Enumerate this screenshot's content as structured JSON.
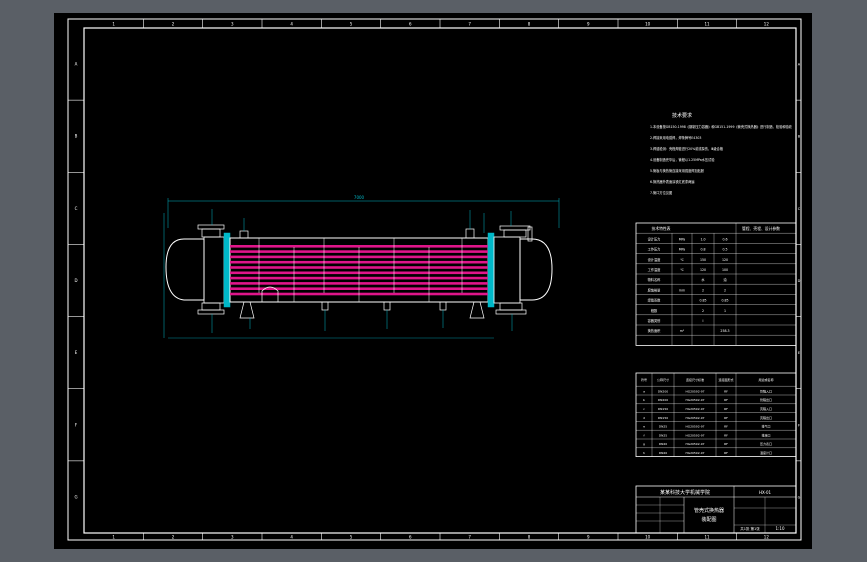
{
  "colors": {
    "background": "#000000",
    "frame": "#ffffff",
    "dimension": "#00b8c8",
    "tubes": "#e0158a",
    "shell": "#ffffff",
    "annotation": "#ffffff"
  },
  "border": {
    "top_columns": [
      "1",
      "2",
      "3",
      "4",
      "5",
      "6",
      "7",
      "8",
      "9",
      "10",
      "11",
      "12"
    ],
    "bottom_columns": [
      "1",
      "2",
      "3",
      "4",
      "5",
      "6",
      "7",
      "8",
      "9",
      "10",
      "11",
      "12"
    ],
    "left_rows": [
      "A",
      "B",
      "C",
      "D",
      "E",
      "F",
      "G"
    ],
    "right_rows": [
      "A",
      "B",
      "C",
      "D",
      "E",
      "F",
      "G"
    ]
  },
  "technical_requirements": {
    "title": "技术要求",
    "lines": [
      "1.本设备按GB150-1998《钢制压力容器》和GB151-1999《管壳式换热器》进行制造、检验和验收",
      "2.焊接采用电弧焊，焊条牌号E4303",
      "3.焊缝检测：壳程焊缝进行20%射线探伤，Ⅲ级合格",
      "4.设备制造完毕后，管程以1.25MPa水压试验",
      "5.管板与换热管连接采用强度焊加贴胀",
      "6.换热器外表面涂铁红底漆两遍",
      "7.管口方位见图"
    ]
  },
  "design_table": {
    "header": [
      "技术特性表",
      "",
      "管程、壳程、设计参数"
    ],
    "rows": [
      [
        "设计压力",
        "MPa",
        "1.0",
        "0.6"
      ],
      [
        "工作压力",
        "MPa",
        "0.8",
        "0.5"
      ],
      [
        "设计温度",
        "℃",
        "150",
        "120"
      ],
      [
        "工作温度",
        "℃",
        "120",
        "100"
      ],
      [
        "物料名称",
        "",
        "水",
        "油"
      ],
      [
        "腐蚀裕量",
        "mm",
        "2",
        "2"
      ],
      [
        "焊缝系数",
        "",
        "0.85",
        "0.85"
      ],
      [
        "程数",
        "",
        "2",
        "1"
      ],
      [
        "容器类别",
        "",
        "Ⅰ",
        ""
      ],
      [
        "换热面积",
        "m²",
        "",
        "258.3"
      ]
    ]
  },
  "nozzle_table": {
    "header": [
      "符号",
      "公称尺寸",
      "连接尺寸标准",
      "连接面形式",
      "用途或名称"
    ],
    "rows": [
      [
        "a",
        "DN200",
        "HG20592-97",
        "RF",
        "管程入口"
      ],
      [
        "b",
        "DN200",
        "HG20592-97",
        "RF",
        "管程出口"
      ],
      [
        "c",
        "DN150",
        "HG20592-97",
        "RF",
        "壳程入口"
      ],
      [
        "d",
        "DN150",
        "HG20592-97",
        "RF",
        "壳程出口"
      ],
      [
        "e",
        "DN25",
        "HG20592-97",
        "RF",
        "排气口"
      ],
      [
        "f",
        "DN25",
        "HG20592-97",
        "RF",
        "排液口"
      ],
      [
        "g",
        "DN20",
        "HG20592-97",
        "RF",
        "压力表口"
      ],
      [
        "h",
        "DN20",
        "HG20592-97",
        "RF",
        "温度计口"
      ]
    ]
  },
  "title_block": {
    "school": "某某科技大学机械学院",
    "drawing_title": "管壳式换热器",
    "subtitle": "装配图",
    "drawing_no": "HX-01",
    "scale": "1:10",
    "sheet": "共1张 第1张"
  },
  "drawing": {
    "overall_dimension": "7000",
    "tube_count": 10
  }
}
